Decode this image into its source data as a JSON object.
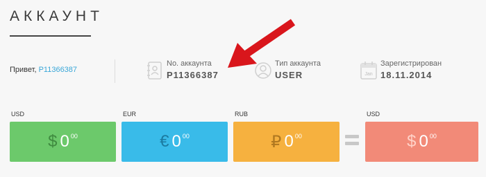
{
  "page": {
    "title": "АККАУНТ"
  },
  "greeting": {
    "prefix": "Привет, ",
    "account": "P11366387"
  },
  "info": [
    {
      "icon": "address-book-icon",
      "label": "No. аккаунта",
      "value": "P11366387"
    },
    {
      "icon": "user-icon",
      "label": "Тип аккаунта",
      "value": "USER"
    },
    {
      "icon": "calendar-icon",
      "label": "Зарегистрирован",
      "value": "18.11.2014",
      "icon_text": "Jan"
    }
  ],
  "balances": [
    {
      "currency": "USD",
      "symbol": "$",
      "amount": "0",
      "decimals": "00",
      "color": "#6cc96b"
    },
    {
      "currency": "EUR",
      "symbol": "€",
      "amount": "0",
      "decimals": "00",
      "color": "#39bbe9"
    },
    {
      "currency": "RUB",
      "symbol": "₽",
      "amount": "0",
      "decimals": "00",
      "color": "#f6b13f"
    }
  ],
  "total": {
    "currency": "USD",
    "symbol": "$",
    "amount": "0",
    "decimals": "00",
    "color": "#f28a78"
  },
  "annotation": {
    "arrow_color": "#d9161c"
  }
}
